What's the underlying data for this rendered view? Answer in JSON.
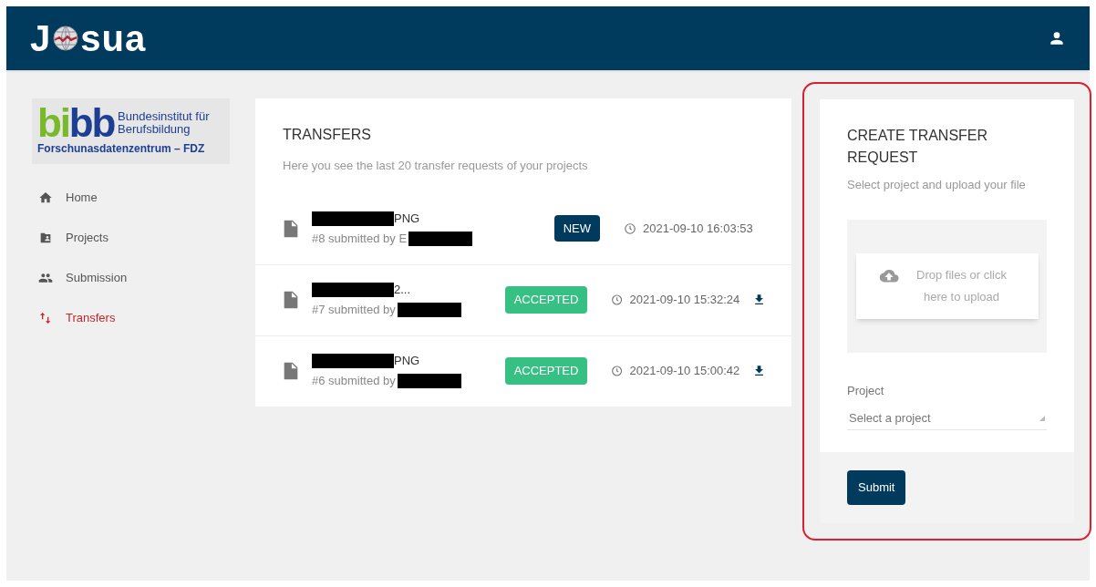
{
  "header": {
    "logo": {
      "first": "J",
      "rest": "sua"
    }
  },
  "sidebar": {
    "org_logo": {
      "mark_green": "bi",
      "mark_blue": "bb",
      "line_1": "Bundesinstitut für",
      "line_2": "Berufsbildung",
      "subtitle": "Forschunasdatenzentrum – FDZ"
    },
    "items": [
      {
        "label": "Home",
        "kind": "home",
        "selected": false
      },
      {
        "label": "Projects",
        "kind": "folder",
        "selected": false
      },
      {
        "label": "Submission",
        "kind": "people",
        "selected": false
      },
      {
        "label": "Transfers",
        "kind": "transfer",
        "selected": true
      }
    ]
  },
  "transfers": {
    "title": "TRANSFERS",
    "subtitle": "Here you see the last 20 transfer requests of your projects",
    "rows": [
      {
        "name": "PNG",
        "submitted": "#8 submitted by E",
        "status": "NEW",
        "kind": "new",
        "time": "2021-09-10 16:03:53",
        "downloadable": false
      },
      {
        "name": "2...",
        "submitted": "#7 submitted by",
        "status": "ACCEPTED",
        "kind": "accepted",
        "time": "2021-09-10 15:32:24",
        "downloadable": true
      },
      {
        "name": "PNG",
        "submitted": "#6 submitted by",
        "status": "ACCEPTED",
        "kind": "accepted",
        "time": "2021-09-10 15:00:42",
        "downloadable": true
      }
    ]
  },
  "create": {
    "highlighted": true,
    "title": "CREATE TRANSFER REQUEST",
    "subtitle": "Select project and upload your file",
    "dropzone": "Drop files or click here to upload",
    "project_label": "Project",
    "project_placeholder": "Select a project",
    "submit": "Submit"
  }
}
